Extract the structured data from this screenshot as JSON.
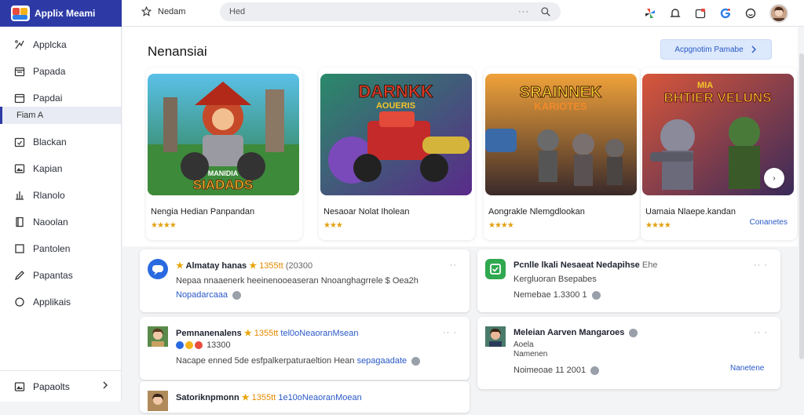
{
  "app": {
    "title": "Applix Meami"
  },
  "header": {
    "nav_label": "Nedam",
    "search_value": "Hed",
    "search_dots": "···"
  },
  "sidebar": {
    "items": [
      {
        "label": "Applcka",
        "icon": "sparkle-icon"
      },
      {
        "label": "Papada",
        "icon": "calendar-icon"
      },
      {
        "label": "Papdai",
        "icon": "calendar-alt-icon"
      },
      {
        "label": "Blackan",
        "icon": "calendar-check-icon"
      },
      {
        "label": "Kapian",
        "icon": "image-icon"
      },
      {
        "label": "Rlanolo",
        "icon": "chart-icon"
      },
      {
        "label": "Naoolan",
        "icon": "book-icon"
      },
      {
        "label": "Pantolen",
        "icon": "square-icon"
      },
      {
        "label": "Papantas",
        "icon": "pen-icon"
      },
      {
        "label": "Applikais",
        "icon": "circle-icon"
      }
    ],
    "sub_item": "Fiam A",
    "footer_label": "Papaolts"
  },
  "featured": {
    "title": "Nenansiai",
    "button_label": "Acpgnotim Pamabe",
    "cards": [
      {
        "title": "Nengia Hedian Panpandan",
        "stars": "★★★★",
        "art_text": "SIADADS",
        "art_sub": "MANIDIA"
      },
      {
        "title": "Nesaoar Nolat Iholean",
        "stars": "★★★",
        "art_text": "DARNKK",
        "art_sub": "AOUERIS"
      },
      {
        "title": "Aongrakle Nlemgdlookan",
        "stars": "★★★★",
        "art_text": "SRAINNEK",
        "art_sub": "KARIOTES"
      },
      {
        "title": "Uamaia Nlaepe.kandan",
        "stars": "★★★★",
        "art_text": "BHTIER VELUNS",
        "art_sub": "MIA",
        "link": "Conanetes"
      }
    ]
  },
  "list": [
    {
      "title": "Almatay hanas",
      "rating": "1355tt",
      "meta": "(20300",
      "line1": "Nepaa nnaaenerk heeinenooeaseran Nnoanghagrrele $ Oea2h",
      "line2": "Nopadarcaaa",
      "more": "··"
    },
    {
      "title": "Pcnlle lkali  Nesaeat Nedapihse",
      "meta": "Ehe",
      "line1": "Kergluoran  Bsepabes",
      "line2": "Nemebae 1.3300 1",
      "more": "·· ·"
    },
    {
      "title": "Pemnanenalens",
      "rating": "1355tt",
      "meta": "tel0oNeaoranMsean",
      "sub": "13300",
      "line1": "Nacape enned  5de  esfpalkerpaturaeltion  Hean",
      "link": "sepagaadate",
      "more": "·· ·"
    },
    {
      "title": "Meleian Aarven Mangaroes",
      "sub": "Aoela",
      "line1": "Namenen",
      "line2": "Noimeoae 11 2001",
      "link": "Nanetene",
      "more": "·· ·"
    },
    {
      "title": "Satoriknpmonn",
      "rating": "1355tt",
      "meta": "1e10oNeaoranMoean"
    }
  ],
  "colors": {
    "brand": "#2d3aa6",
    "accent": "#2a59c7",
    "star": "#e2a012"
  }
}
